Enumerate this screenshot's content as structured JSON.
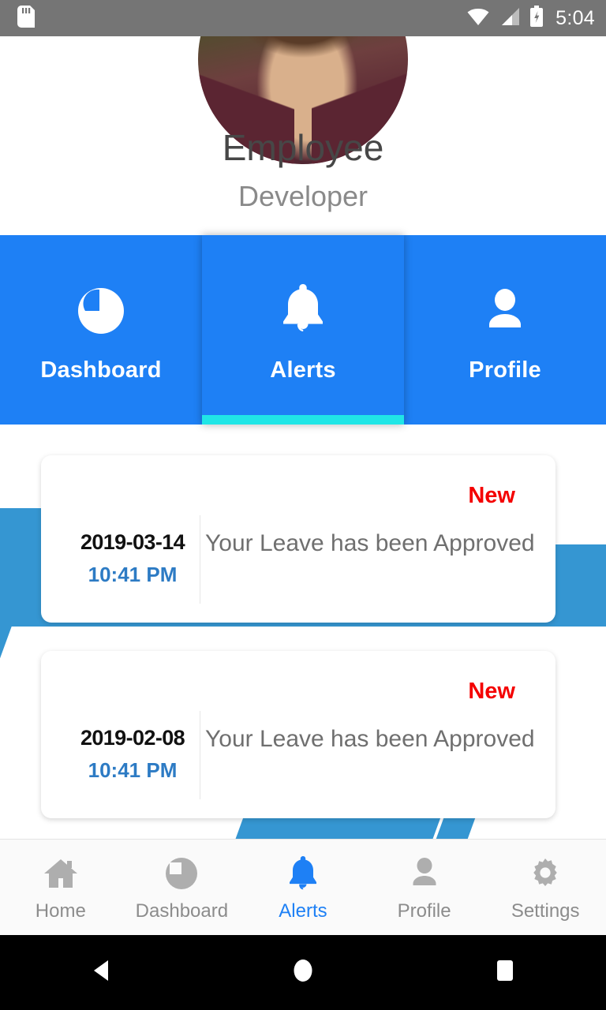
{
  "status_bar": {
    "time": "5:04",
    "icons": [
      "sd-card-icon",
      "wifi-icon",
      "cellular-signal-icon",
      "battery-charging-icon"
    ],
    "background_color": "#757575"
  },
  "profile": {
    "name": "Employee",
    "role": "Developer",
    "avatar_alt": "employee-avatar"
  },
  "top_tabs": {
    "active_index": 1,
    "accent_color": "#1E80F5",
    "indicator_color": "#20E6E6",
    "items": [
      {
        "label": "Dashboard",
        "icon": "pie-chart-icon"
      },
      {
        "label": "Alerts",
        "icon": "bell-icon"
      },
      {
        "label": "Profile",
        "icon": "person-icon"
      }
    ]
  },
  "alerts": {
    "badge_label": "New",
    "badge_color": "#F40000",
    "items": [
      {
        "date": "2019-03-14",
        "time": "10:41 PM",
        "message": "Your Leave has been Approved",
        "badge": "New"
      },
      {
        "date": "2019-02-08",
        "time": "10:41 PM",
        "message": "Your Leave has been Approved",
        "badge": "New"
      }
    ]
  },
  "bottom_nav": {
    "active_index": 2,
    "active_color": "#1E80F5",
    "items": [
      {
        "label": "Home",
        "icon": "home-icon"
      },
      {
        "label": "Dashboard",
        "icon": "pie-chart-icon"
      },
      {
        "label": "Alerts",
        "icon": "bell-icon"
      },
      {
        "label": "Profile",
        "icon": "person-icon"
      },
      {
        "label": "Settings",
        "icon": "gear-icon"
      }
    ]
  },
  "android_nav": {
    "items": [
      {
        "name": "back-button",
        "icon": "triangle-left-icon"
      },
      {
        "name": "home-button",
        "icon": "circle-icon"
      },
      {
        "name": "recents-button",
        "icon": "square-icon"
      }
    ]
  }
}
